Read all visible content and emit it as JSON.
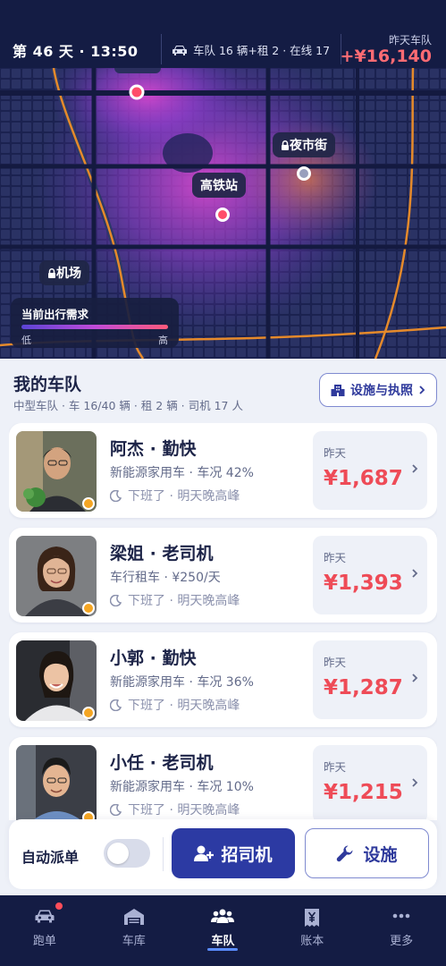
{
  "topbar": {
    "day_time": "第 46 天 · 13:50",
    "fleet_summary": "车队 16 辆+租 2 · 在线 17",
    "yesterday_label": "昨天车队",
    "yesterday_value": "+¥16,140"
  },
  "map": {
    "pins": [
      {
        "label": "高铁站"
      },
      {
        "label": "夜市街"
      },
      {
        "label": "机场"
      }
    ],
    "legend": {
      "title": "当前出行需求",
      "low": "低",
      "high": "高"
    }
  },
  "fleet": {
    "title": "我的车队",
    "subtitle": "中型车队 · 车 16/40 辆 · 租 2 辆 · 司机 17 人",
    "facility_button": "设施与执照"
  },
  "drivers": [
    {
      "name": "阿杰 · 勤快",
      "detail": "新能源家用车 · 车况 42%",
      "shift": "下班了 · 明天晚高峰",
      "earn_label": "昨天",
      "earn_value": "¥1,687"
    },
    {
      "name": "梁姐 · 老司机",
      "detail": "车行租车 · ¥250/天",
      "shift": "下班了 · 明天晚高峰",
      "earn_label": "昨天",
      "earn_value": "¥1,393"
    },
    {
      "name": "小郭 · 勤快",
      "detail": "新能源家用车 · 车况 36%",
      "shift": "下班了 · 明天晚高峰",
      "earn_label": "昨天",
      "earn_value": "¥1,287"
    },
    {
      "name": "小任 · 老司机",
      "detail": "新能源家用车 · 车况 10%",
      "shift": "下班了 · 明天晚高峰",
      "earn_label": "昨天",
      "earn_value": "¥1,215"
    }
  ],
  "actions": {
    "auto_dispatch": "自动派单",
    "auto_dispatch_on": false,
    "recruit": "招司机",
    "facility": "设施"
  },
  "nav": [
    {
      "label": "跑单",
      "icon": "car-icon",
      "badge": true
    },
    {
      "label": "车库",
      "icon": "garage-icon"
    },
    {
      "label": "车队",
      "icon": "team-icon",
      "active": true
    },
    {
      "label": "账本",
      "icon": "ledger-icon"
    },
    {
      "label": "更多",
      "icon": "more-icon"
    }
  ],
  "colors": {
    "nav_bg": "#141c44",
    "accent": "#2c3aa3",
    "earning": "#ee4b57",
    "status_dot": "#f5a623"
  }
}
